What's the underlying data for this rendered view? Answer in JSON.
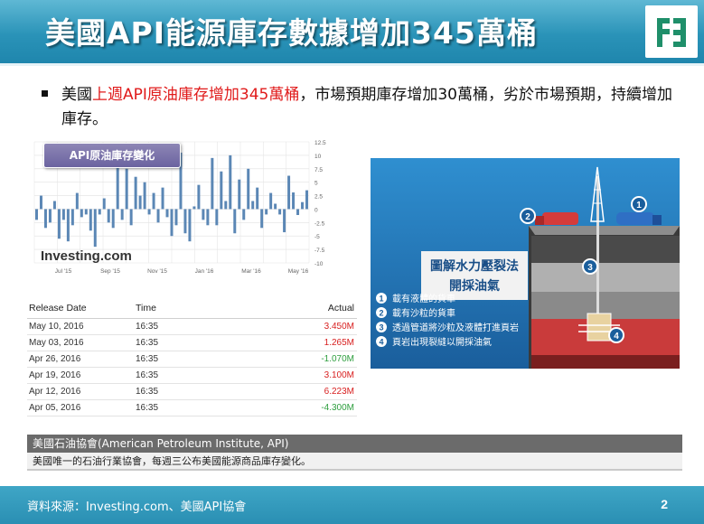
{
  "slide": {
    "title": "美國API能源庫存數據增加345萬桶",
    "bullet": {
      "prefix": "美國",
      "highlight": "上週API原油庫存增加345萬桶",
      "suffix": "，市場預期庫存增加30萬桶，劣於市場預期，持續增加庫存。"
    },
    "page_number": "2",
    "source": "資料來源：Investing.com、美國API協會"
  },
  "chart_data": {
    "type": "bar",
    "title": "API原油庫存變化",
    "watermark": "Investing.com",
    "x_tick_labels": [
      "Jul '15",
      "Sep '15",
      "Nov '15",
      "Jan '16",
      "Mar '16",
      "May '16"
    ],
    "y_ticks": [
      12.5,
      10,
      7.5,
      5,
      2.5,
      0,
      -2.5,
      -5,
      -7.5,
      -10
    ],
    "ylim": [
      -10,
      12.5
    ],
    "values": [
      -2.0,
      2.5,
      -3.5,
      -2.5,
      1.5,
      -5.5,
      -2.0,
      -6.0,
      -3.0,
      3.0,
      -1.5,
      -1.0,
      -4.0,
      -7.0,
      -1.0,
      2.0,
      -2.5,
      -3.5,
      9.0,
      -2.0,
      7.5,
      -3.0,
      6.0,
      2.5,
      5.0,
      -1.0,
      3.0,
      -2.5,
      4.0,
      -1.5,
      -5.0,
      -3.0,
      10.5,
      -4.5,
      -6.0,
      0.5,
      4.5,
      -2.0,
      -3.0,
      9.5,
      -3.0,
      7.0,
      1.5,
      10.0,
      -4.5,
      5.5,
      -2.0,
      7.5,
      1.5,
      4.0,
      -3.5,
      -1.0,
      3.0,
      1.0,
      -1.0,
      -4.3,
      6.2,
      3.1,
      -1.1,
      1.3,
      3.5
    ],
    "grid": true,
    "colors": {
      "bar": "#5b87b5",
      "grid": "#e2e2e2"
    }
  },
  "release_table": {
    "headers": [
      "Release Date",
      "Time",
      "Actual"
    ],
    "rows": [
      {
        "date": "May 10, 2016",
        "time": "16:35",
        "actual": "3.450M",
        "sign": "pos"
      },
      {
        "date": "May 03, 2016",
        "time": "16:35",
        "actual": "1.265M",
        "sign": "pos"
      },
      {
        "date": "Apr 26, 2016",
        "time": "16:35",
        "actual": "-1.070M",
        "sign": "neg"
      },
      {
        "date": "Apr 19, 2016",
        "time": "16:35",
        "actual": "3.100M",
        "sign": "pos"
      },
      {
        "date": "Apr 12, 2016",
        "time": "16:35",
        "actual": "6.223M",
        "sign": "pos"
      },
      {
        "date": "Apr 05, 2016",
        "time": "16:35",
        "actual": "-4.300M",
        "sign": "neg"
      }
    ]
  },
  "illustration": {
    "title_lines": [
      "圖解水力壓裂法",
      "開採油氣"
    ],
    "legend": [
      {
        "num": "1",
        "text": "載有液體的貨車"
      },
      {
        "num": "2",
        "text": "載有沙粒的貨車"
      },
      {
        "num": "3",
        "text": "透過管道將沙粒及液體打進頁岩"
      },
      {
        "num": "4",
        "text": "頁岩出現裂縫以開採油氣"
      }
    ],
    "markers": [
      "1",
      "2",
      "3",
      "4"
    ]
  },
  "api_box": {
    "heading": "美國石油協會(American Petroleum Institute, API)",
    "body": "美國唯一的石油行業協會，每週三公布美國能源商品庫存變化。"
  },
  "logo": {
    "name": "fubon-logo-icon"
  }
}
